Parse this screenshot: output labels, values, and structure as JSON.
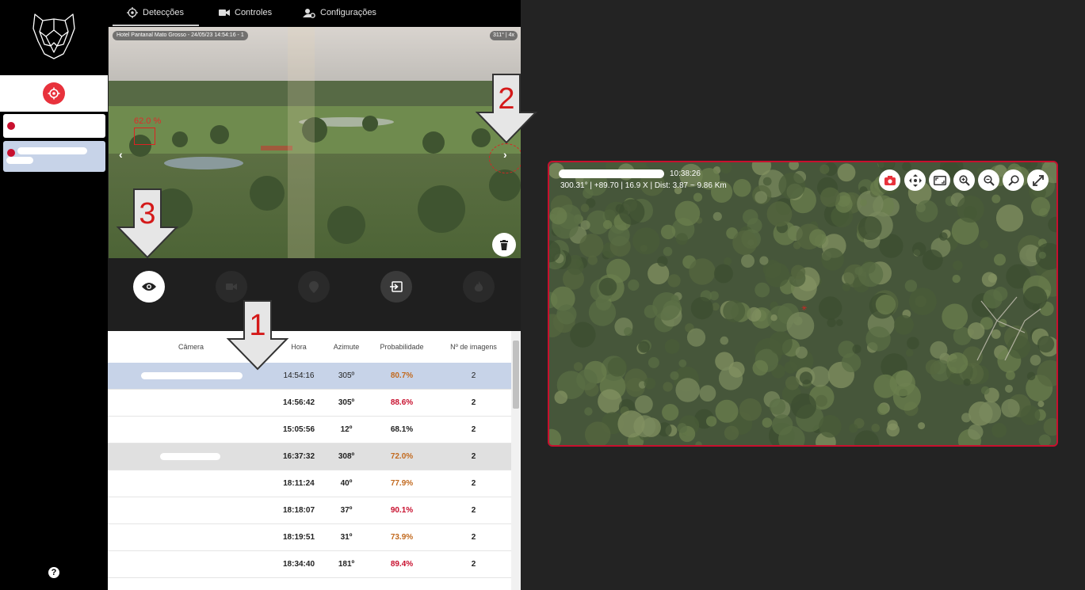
{
  "tabs": [
    {
      "label": "Detecções"
    },
    {
      "label": "Controles"
    },
    {
      "label": "Configurações"
    }
  ],
  "image": {
    "caption": "Hotel Pantanal Mato Grosso - 24/05/23 14:54:16 - 1",
    "zoom": "311° | 4x",
    "detection_label": "62.0 %"
  },
  "table": {
    "headers": [
      "Câmera",
      "Hora",
      "Azimute",
      "Probabilidade",
      "Nº de imagens"
    ],
    "rows": [
      {
        "hora": "14:54:16",
        "azimute": "305º",
        "prob": "80.7%",
        "imagens": "2"
      },
      {
        "hora": "14:56:42",
        "azimute": "305º",
        "prob": "88.6%",
        "imagens": "2"
      },
      {
        "hora": "15:05:56",
        "azimute": "12º",
        "prob": "68.1%",
        "imagens": "2"
      },
      {
        "hora": "16:37:32",
        "azimute": "308º",
        "prob": "72.0%",
        "imagens": "2"
      },
      {
        "hora": "18:11:24",
        "azimute": "40º",
        "prob": "77.9%",
        "imagens": "2"
      },
      {
        "hora": "18:18:07",
        "azimute": "37º",
        "prob": "90.1%",
        "imagens": "2"
      },
      {
        "hora": "18:19:51",
        "azimute": "31º",
        "prob": "73.9%",
        "imagens": "2"
      },
      {
        "hora": "18:34:40",
        "azimute": "181º",
        "prob": "89.4%",
        "imagens": "2"
      }
    ]
  },
  "viewer": {
    "time": "10:38:26",
    "info": "300.31° | +89.70 | 16.9 X | Dist: 3.87 ~ 9.86 Km"
  },
  "sidebar": {
    "help": "?"
  },
  "callouts": {
    "one": "1",
    "two": "2",
    "three": "3"
  },
  "colors": {
    "accent": "#e8323c",
    "selected_row": "#c7d3e8",
    "highlight_row": "#e0e0e0",
    "prob_orange": "#c26a1f",
    "prob_red": "#c8102e"
  }
}
